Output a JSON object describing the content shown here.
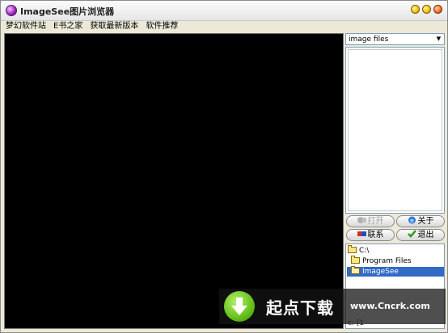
{
  "window": {
    "title": "ImageSee图片浏览器"
  },
  "menu": {
    "items": [
      {
        "label": "梦幻软件站"
      },
      {
        "label": "E书之家"
      },
      {
        "label": "获取最新版本"
      },
      {
        "label": "软件推荐"
      }
    ]
  },
  "sidebar": {
    "filter_value": "image files",
    "buttons": {
      "open": "打开",
      "about": "关于",
      "contact": "联系",
      "exit": "退出"
    },
    "tree": {
      "items": [
        {
          "label": "C:\\"
        },
        {
          "label": "Program Files"
        },
        {
          "label": "ImageSee"
        }
      ],
      "selected": "ImageSee",
      "drive": "c: [1"
    }
  },
  "watermark": {
    "brand": "起点下载",
    "url": "www.Cncrk.com"
  },
  "colors": {
    "viewer_bg": "#000000",
    "selection": "#316ac5",
    "watermark_green": "#64c01a"
  }
}
